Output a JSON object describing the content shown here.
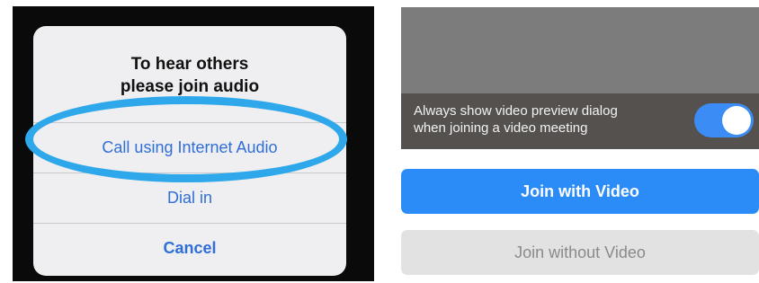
{
  "audio_dialog": {
    "title": "To hear others\nplease join audio",
    "options": [
      {
        "label": "Call using Internet Audio"
      },
      {
        "label": "Dial in"
      },
      {
        "label": "Cancel"
      }
    ],
    "highlight_color": "#2ea8ea",
    "option_color": "#2f6fd6"
  },
  "video_preview": {
    "toggle_text": "Always show video preview dialog\nwhen joining a video meeting",
    "toggle_on": true,
    "toggle_color": "#3b8df5",
    "join_with_video_label": "Join with Video",
    "join_without_video_label": "Join without Video",
    "primary_color": "#2c8cf7"
  }
}
